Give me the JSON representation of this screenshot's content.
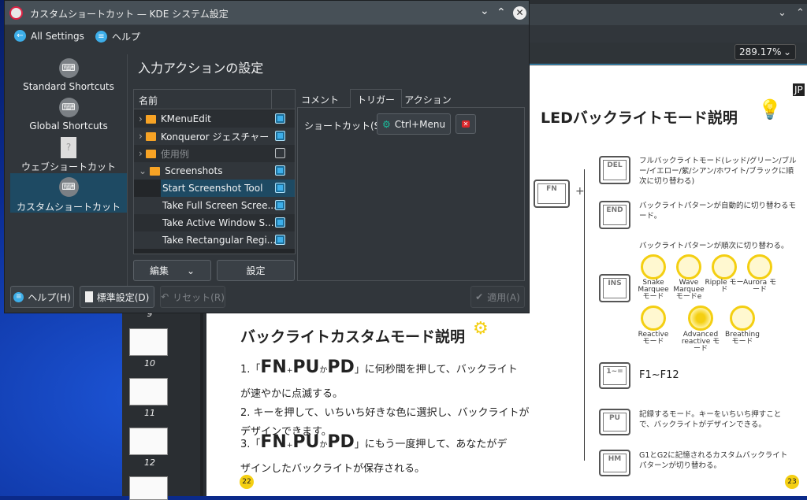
{
  "dialog": {
    "title": "カスタムショートカット — KDE システム設定",
    "toolbar": {
      "all_settings": "All Settings",
      "help": "ヘルプ"
    },
    "sidebar": {
      "items": [
        {
          "label": "Standard Shortcuts",
          "icon": "keyboard-icon"
        },
        {
          "label": "Global Shortcuts",
          "icon": "keyboard-icon"
        },
        {
          "label": "ウェブショートカット",
          "icon": "unknown-file-icon"
        },
        {
          "label": "カスタムショートカット",
          "icon": "keyboard-icon",
          "selected": true
        }
      ]
    },
    "heading": "入力アクションの設定",
    "tree": {
      "header": "名前",
      "rows": [
        {
          "label": "KMenuEdit",
          "folder": true,
          "checked": true
        },
        {
          "label": "Konqueror ジェスチャー",
          "folder": true,
          "checked": true
        },
        {
          "label": "使用例",
          "folder": true,
          "checked": false,
          "disabled": true
        },
        {
          "label": "Screenshots",
          "folder": true,
          "checked": true,
          "expanded": true
        },
        {
          "label": "Start Screenshot Tool",
          "checked": true,
          "selected": true
        },
        {
          "label": "Take Full Screen Scree...",
          "checked": true
        },
        {
          "label": "Take Active Window S...",
          "checked": true
        },
        {
          "label": "Take Rectangular Regi...",
          "checked": true
        }
      ]
    },
    "edit_button": "編集",
    "settings_button": "設定",
    "tabs": [
      "コメント",
      "トリガー",
      "アクション"
    ],
    "shortcut_label": "ショートカット(S):",
    "shortcut_value": "Ctrl+Menu",
    "buttons": {
      "help": "ヘルプ(H)",
      "defaults": "標準設定(D)",
      "reset": "リセット(R)",
      "apply": "適用(A)"
    },
    "accent": "#3daee9"
  },
  "viewer": {
    "zoom": "289.17%",
    "thumbnails": [
      "9",
      "10",
      "11",
      "12"
    ],
    "left_page": {
      "title": "バックライトカスタムモード説明",
      "lines": [
        {
          "n": "1.「",
          "fn": "FN",
          "plus": "+",
          "pu": "PU",
          "ka": "か",
          "pd": "PD",
          "rest": "」に何秒間を押して、バックライト"
        },
        {
          "text": "が速やかに点滅する。"
        },
        {
          "text": "2. キーを押して、いちいち好きな色に選択し、バックライトが"
        },
        {
          "text": "デザインできます。"
        },
        {
          "n": "3.「",
          "fn": "FN",
          "plus": "+",
          "pu": "PU",
          "ka": "か",
          "pd": "PD",
          "rest": "」にもう一度押して、あなたがデ"
        },
        {
          "text": "ザインしたバックライトが保存される。"
        }
      ],
      "page_number": "22"
    },
    "right_page": {
      "badge": "JP",
      "title": "LEDバックライトモード説明",
      "fn_key": "FN",
      "plus": "+",
      "keys": [
        {
          "key": "DEL",
          "desc": "フルバックライトモード(レッド/グリーン/ブルー/イエロー/紫/シアン/ホワイト/ブラックに順次に切り替わる)"
        },
        {
          "key": "END",
          "desc": "バックライトパターンが自動的に切り替わるモード。"
        },
        {
          "key": "INS",
          "desc": "バックライトパターンが順次に切り替わる。"
        },
        {
          "key": "1~=",
          "desc": "F1~F12"
        },
        {
          "key": "PU",
          "desc": "記録するモード。キーをいちいち押すことで、バックライトがデザインできる。"
        },
        {
          "key": "HM",
          "desc": "G1とG2に記憶されるカスタムバックライトパターンが切り替わる。"
        }
      ],
      "modes": [
        "Snake Marquee モード",
        "Wave Marquee モードe",
        "Ripple モード",
        "Aurora モード",
        "Reactive モード",
        "Advanced reactive モード",
        "Breathing モード"
      ],
      "page_number": "23",
      "accent": "#f4cf12"
    }
  }
}
